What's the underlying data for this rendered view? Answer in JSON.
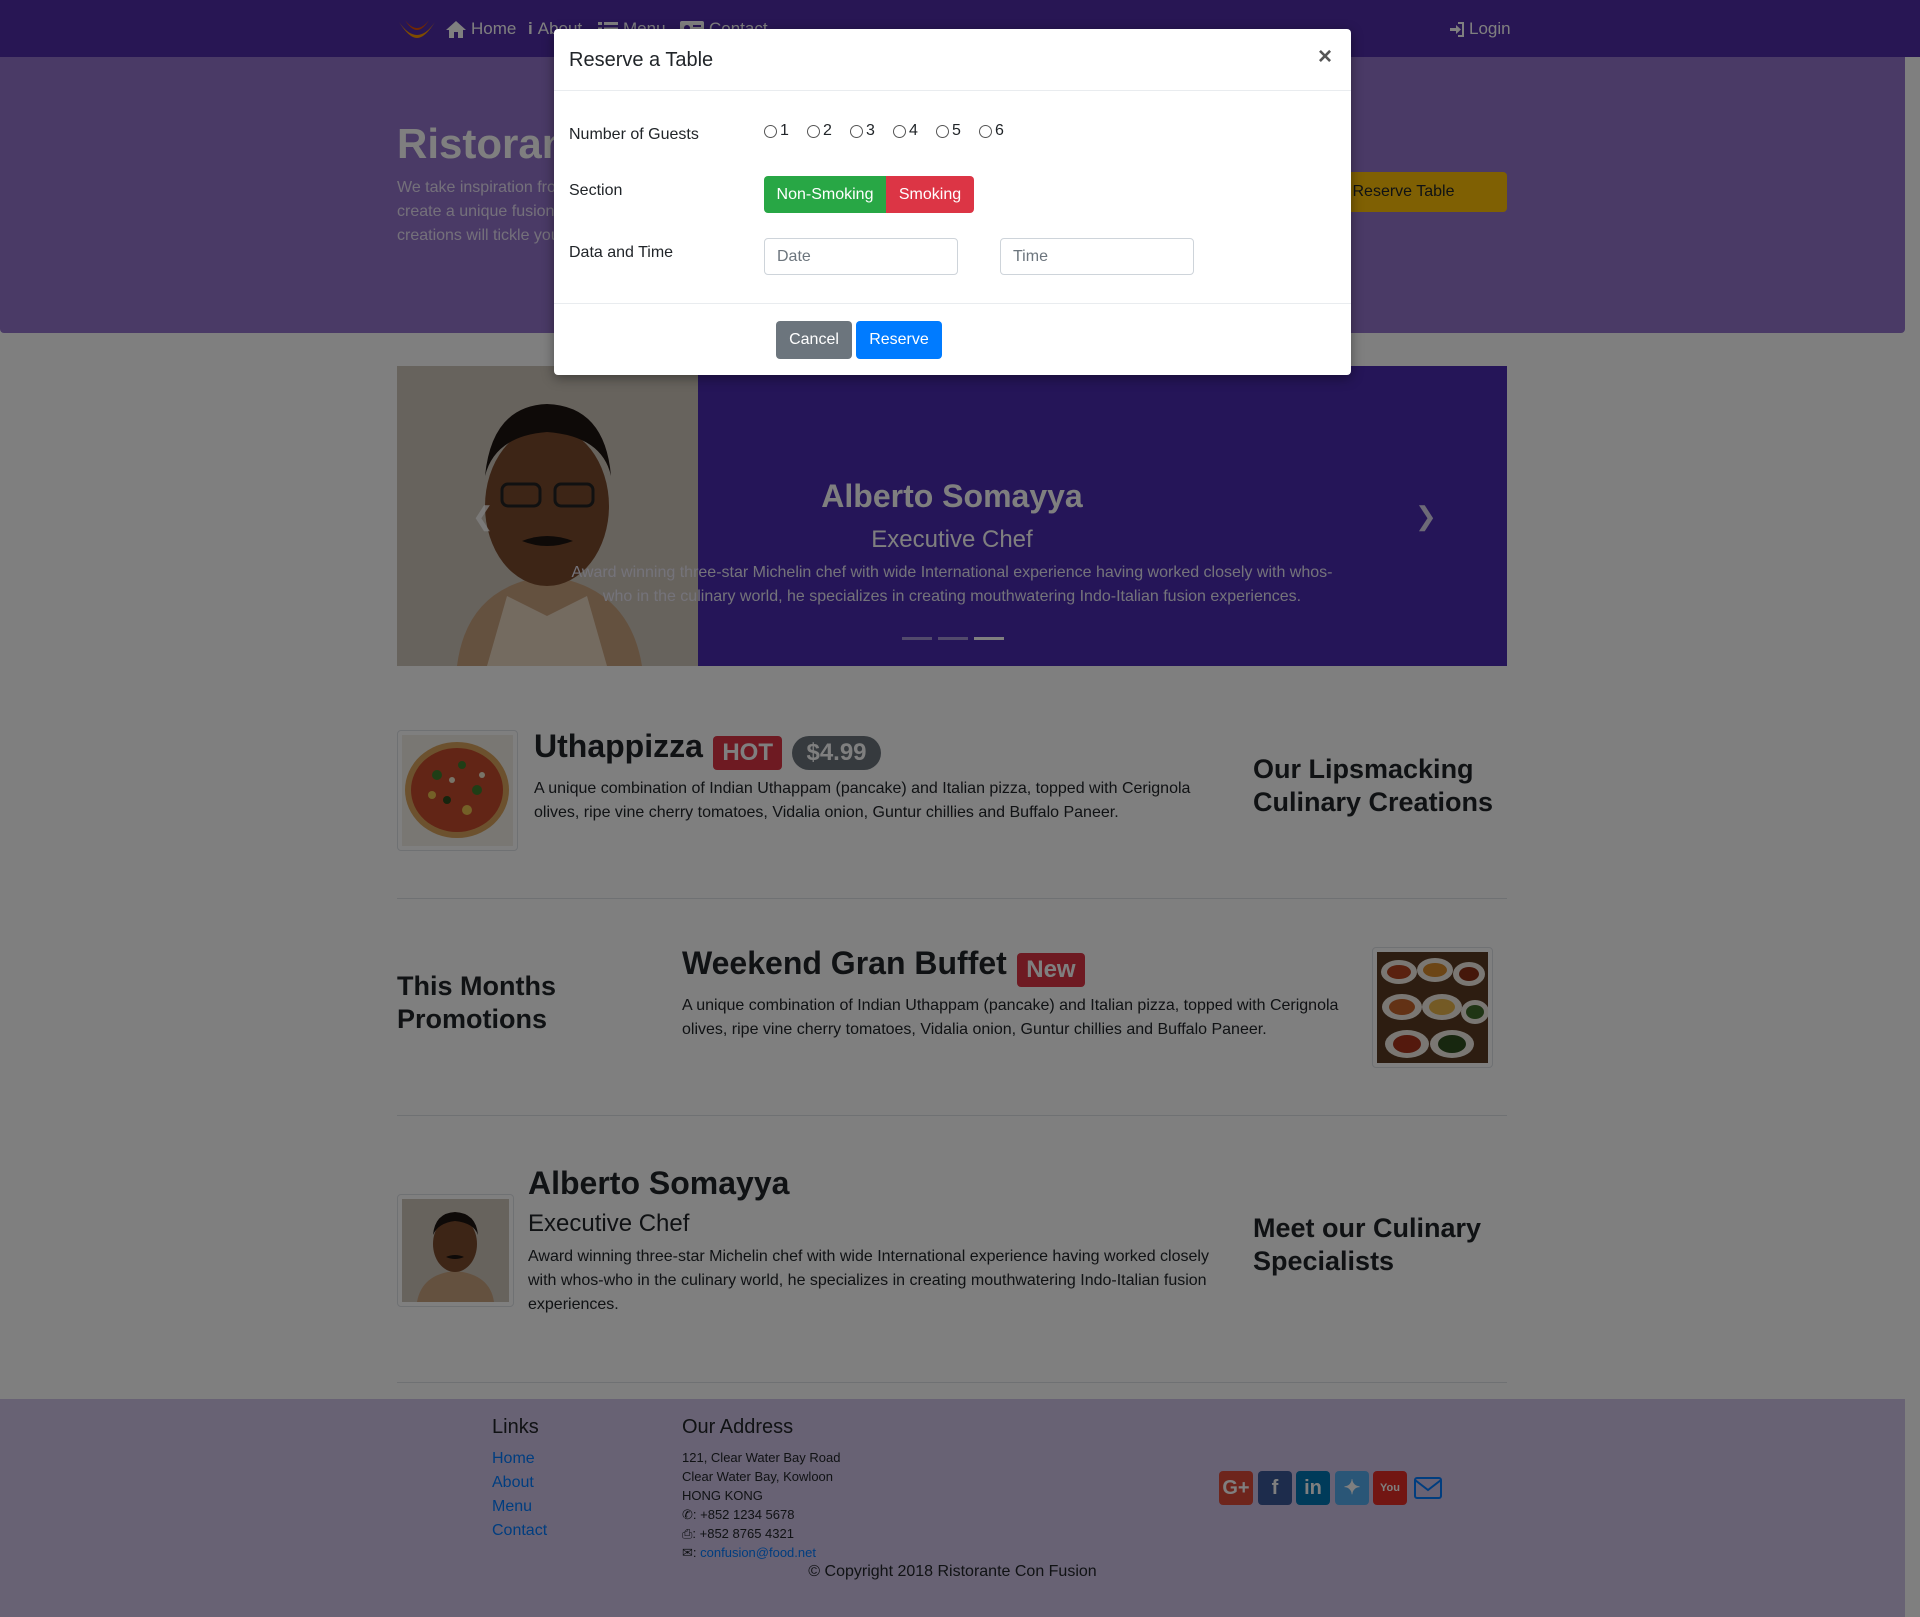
{
  "navbar": {
    "home": "Home",
    "about": "About",
    "menu": "Menu",
    "contact": "Contact",
    "login": "Login"
  },
  "jumbotron": {
    "title": "Ristorante Con Fusion",
    "text": "We take inspiration from the World's best cuisines, and create a unique fusion experience. Our lipsmacking creations will tickle your culinary senses!",
    "reserve_button": "Reserve Table"
  },
  "carousel": {
    "name": "Alberto Somayya",
    "role": "Executive Chef",
    "description": "Award winning three-star Michelin chef with wide International experience having worked closely with whos-who in the culinary world, he specializes in creating mouthwatering Indo-Italian fusion experiences.",
    "indicator_count": 3,
    "active_index": 2
  },
  "dish": {
    "name": "Uthappizza",
    "badge": "HOT",
    "price": "$4.99",
    "description": "A unique combination of Indian Uthappam (pancake) and Italian pizza, topped with Cerignola olives, ripe vine cherry tomatoes, Vidalia onion, Guntur chillies and Buffalo Paneer.",
    "side_heading": "Our Lipsmacking Culinary Creations"
  },
  "promotion": {
    "side_heading": "This Months Promotions",
    "name": "Weekend Gran Buffet",
    "badge": "New",
    "description": "A unique combination of Indian Uthappam (pancake) and Italian pizza, topped with Cerignola olives, ripe vine cherry tomatoes, Vidalia onion, Guntur chillies and Buffalo Paneer."
  },
  "leader": {
    "name": "Alberto Somayya",
    "role": "Executive Chef",
    "description": "Award winning three-star Michelin chef with wide International experience having worked closely with whos-who in the culinary world, he specializes in creating mouthwatering Indo-Italian fusion experiences.",
    "side_heading": "Meet our Culinary Specialists"
  },
  "footer": {
    "links_heading": "Links",
    "links": [
      "Home",
      "About",
      "Menu",
      "Contact"
    ],
    "address_heading": "Our Address",
    "address_lines": [
      "121, Clear Water Bay Road",
      "Clear Water Bay, Kowloon",
      "HONG KONG"
    ],
    "phone": ": +852 1234 5678",
    "fax": ": +852 8765 4321",
    "email": "confusion@food.net",
    "copyright": "© Copyright 2018 Ristorante Con Fusion"
  },
  "social_icons": [
    "google-plus-icon",
    "facebook-icon",
    "linkedin-icon",
    "twitter-icon",
    "youtube-icon",
    "envelope-icon"
  ],
  "modal": {
    "title": "Reserve a Table",
    "close": "×",
    "guests_label": "Number of Guests",
    "guest_options": [
      "1",
      "2",
      "3",
      "4",
      "5",
      "6"
    ],
    "section_label": "Section",
    "non_smoking": "Non-Smoking",
    "smoking": "Smoking",
    "datetime_label": "Data and Time",
    "date_placeholder": "Date",
    "time_placeholder": "Time",
    "cancel": "Cancel",
    "reserve": "Reserve"
  },
  "colors": {
    "navbar": "#512da8",
    "jumbotron": "#9575cd",
    "carousel": "#4a2ab0",
    "footer": "#d1c4e9",
    "warning": "#ffc107",
    "success": "#28a745",
    "danger": "#dc3545",
    "primary": "#007bff",
    "secondary": "#6c757d"
  }
}
